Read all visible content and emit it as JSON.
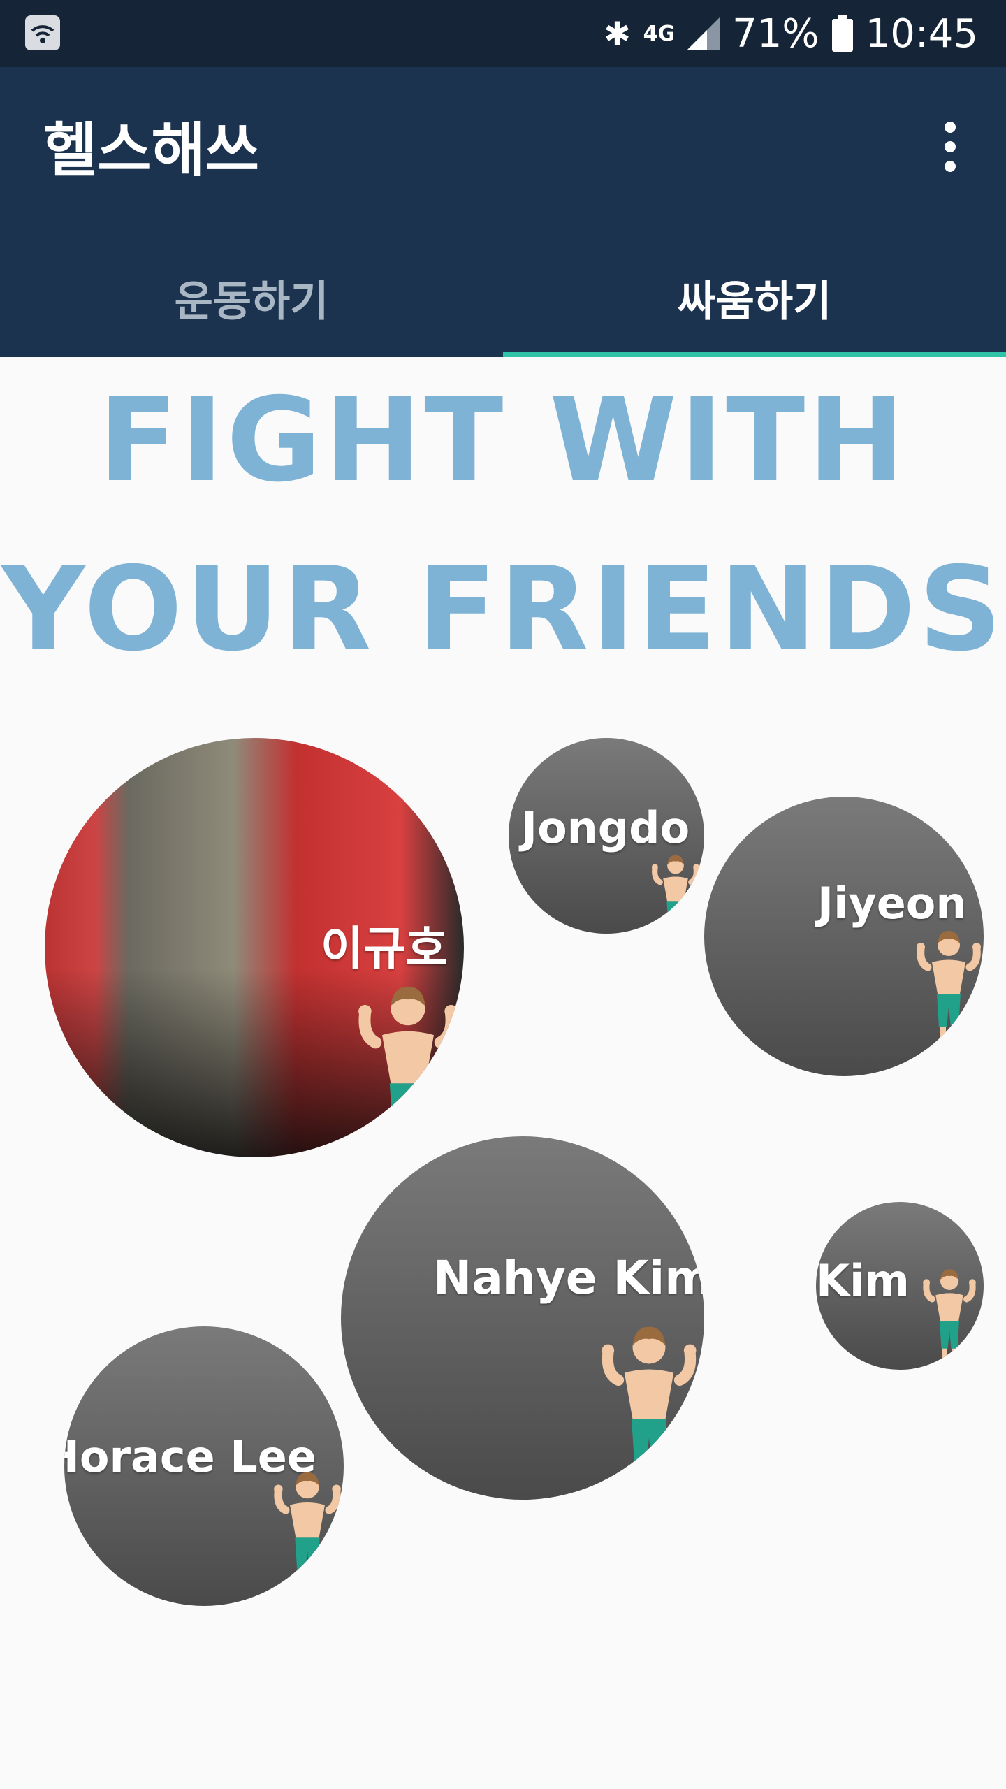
{
  "status_bar": {
    "battery": "71%",
    "time": "10:45",
    "network": "4G"
  },
  "app": {
    "title": "헬스해쓰"
  },
  "tabs": [
    {
      "label": "운동하기",
      "selected": false
    },
    {
      "label": "싸움하기",
      "selected": true
    }
  ],
  "headline": {
    "line1": "FIGHT WITH",
    "line2": "YOUR FRIENDS"
  },
  "friends": [
    {
      "name": "이규호",
      "avatar": "photo"
    },
    {
      "name": "Jongdo",
      "avatar": "default"
    },
    {
      "name": "Jiyeon",
      "avatar": "default"
    },
    {
      "name": "Nahye Kim",
      "avatar": "default"
    },
    {
      "name": "Kim",
      "avatar": "default"
    },
    {
      "name": "Horace Lee",
      "avatar": "default"
    }
  ],
  "colors": {
    "status_bar": "#152436",
    "app_bar": "#1c334f",
    "tab_indicator": "#2fc4a8",
    "headline": "#7fb3d5",
    "bubble": "#5a5a5a"
  }
}
